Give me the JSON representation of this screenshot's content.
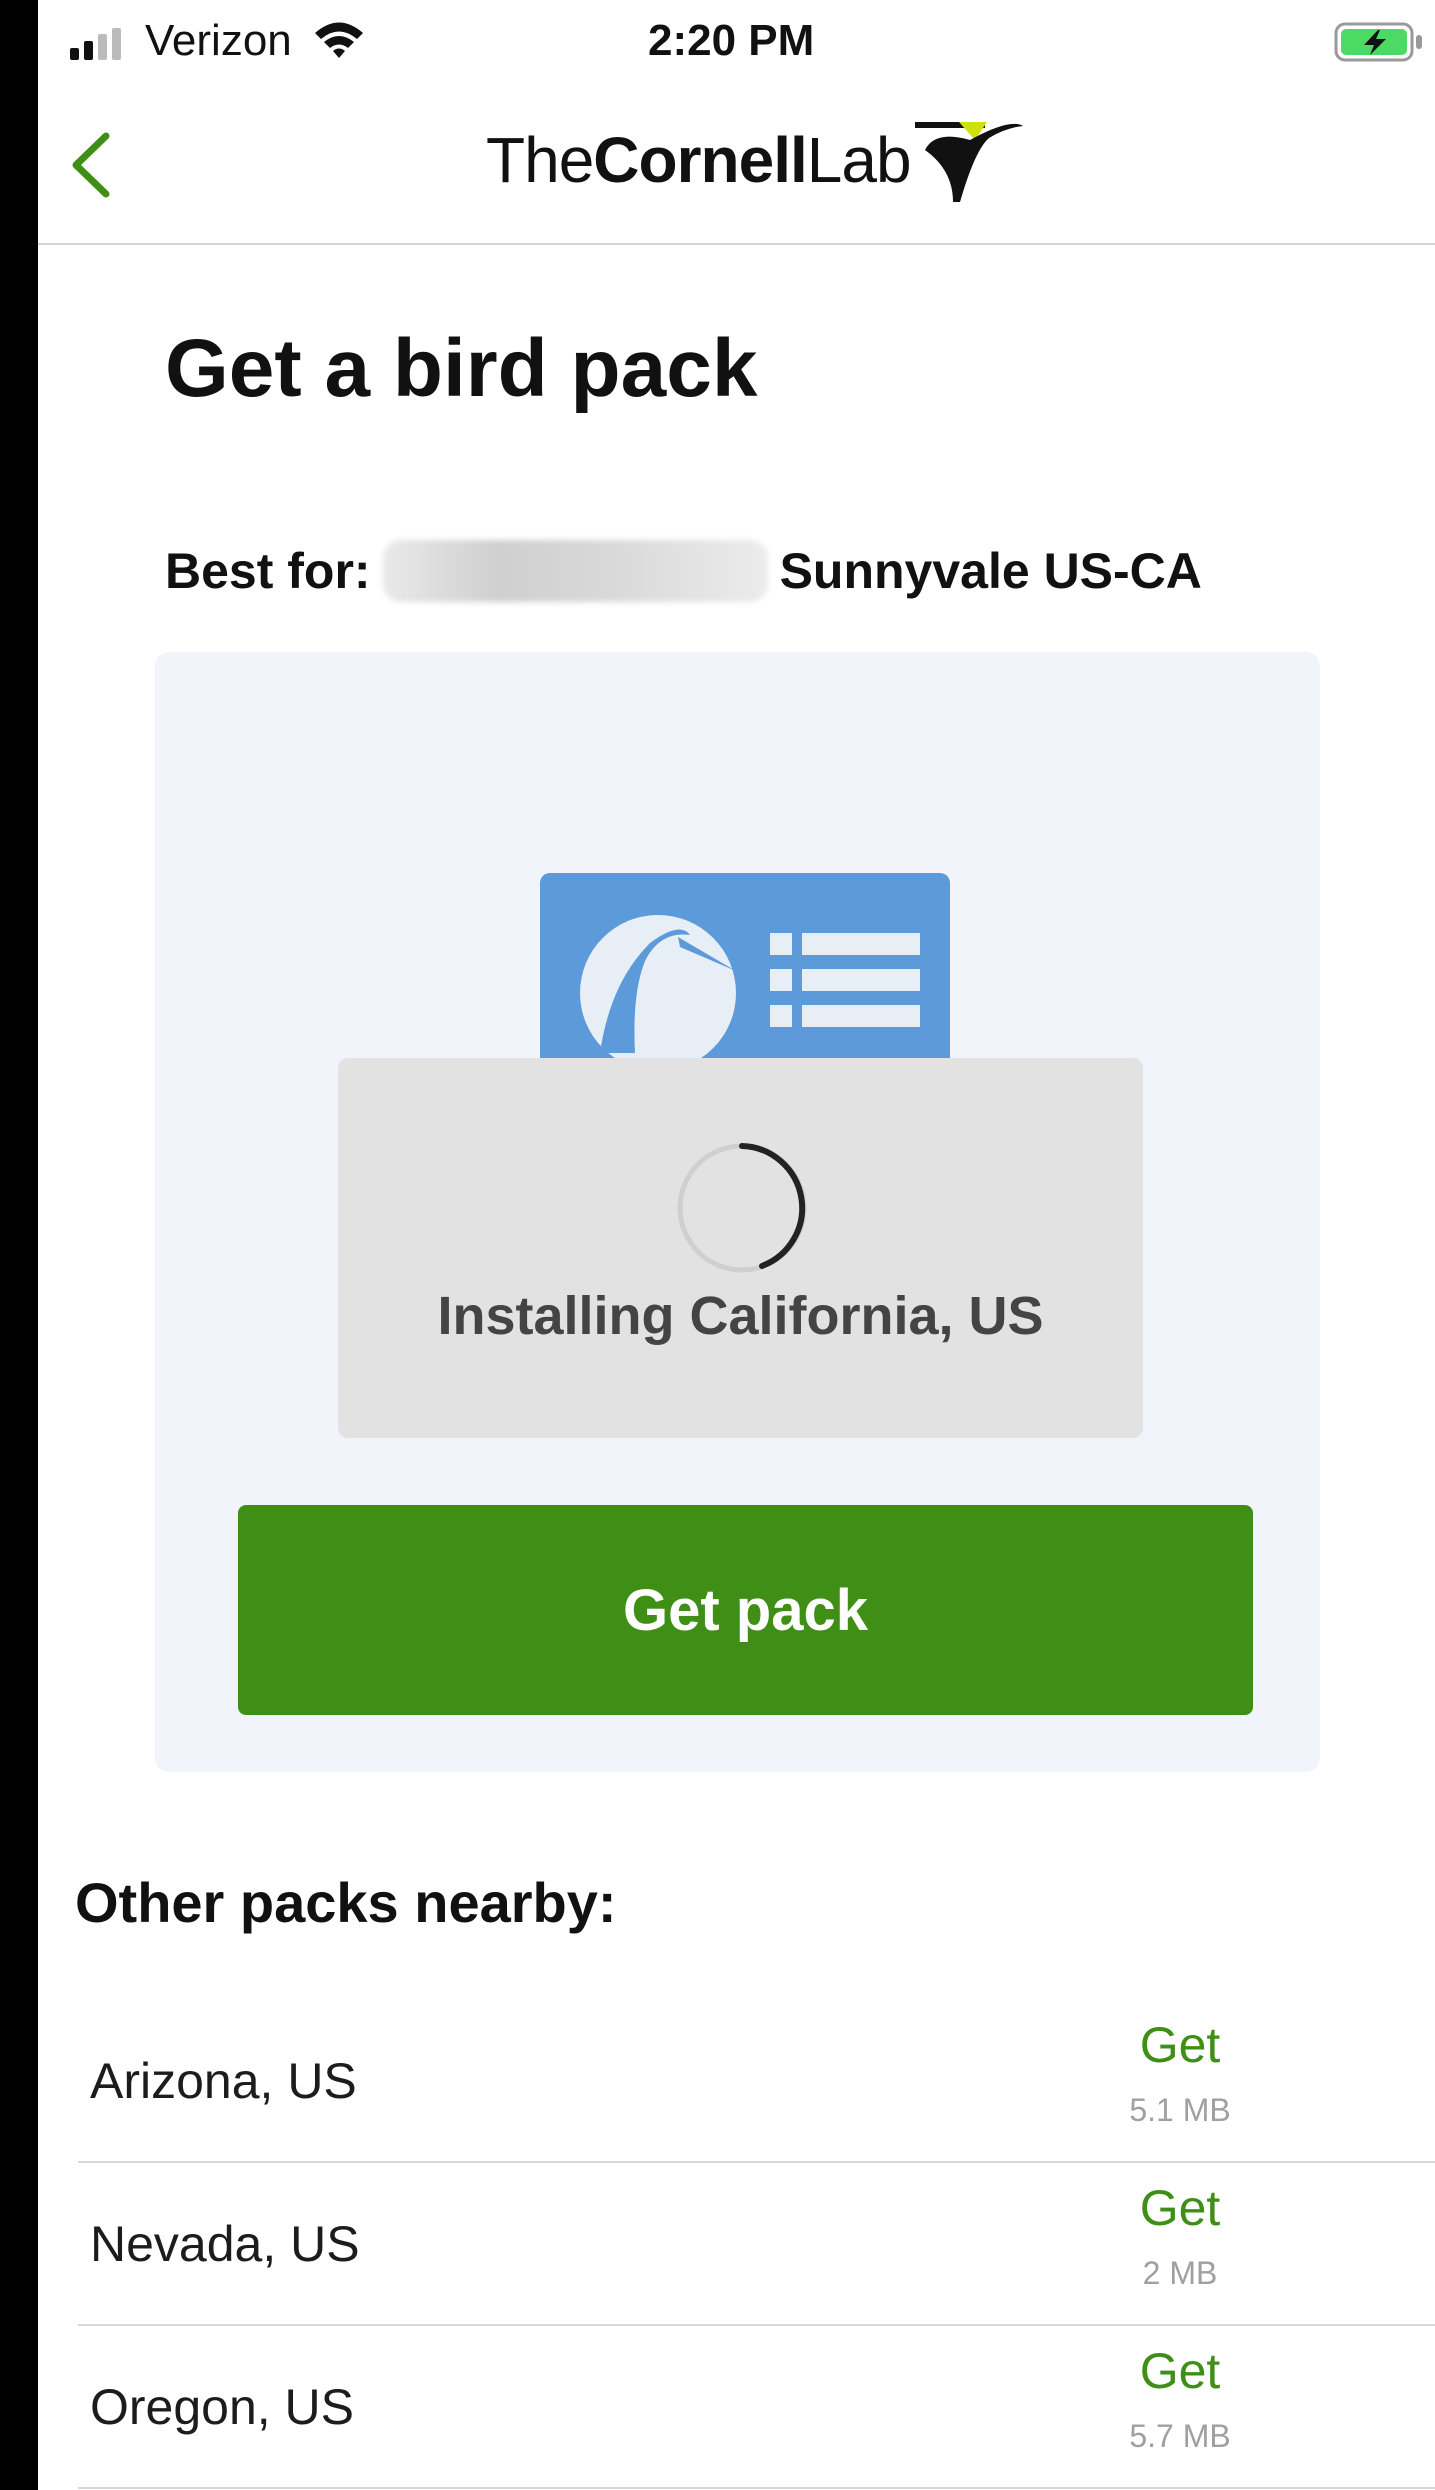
{
  "status_bar": {
    "carrier": "Verizon",
    "time": "2:20 PM",
    "icons": [
      "signal-icon",
      "wifi-icon",
      "battery-charging-icon"
    ]
  },
  "nav": {
    "back_icon": "chevron-left-icon",
    "logo": {
      "the": "The",
      "cornell": "Cornell",
      "lab": "Lab"
    }
  },
  "page": {
    "title": "Get a bird pack",
    "best_for_label": "Best for:",
    "best_for_location": "Sunnyvale US-CA"
  },
  "featured_pack": {
    "installing_text": "Installing California, US",
    "button_label": "Get pack"
  },
  "other_packs": {
    "heading": "Other packs nearby:",
    "items": [
      {
        "name": "Arizona, US",
        "action": "Get",
        "size": "5.1 MB"
      },
      {
        "name": "Nevada, US",
        "action": "Get",
        "size": "2 MB"
      },
      {
        "name": "Oregon, US",
        "action": "Get",
        "size": "5.7 MB"
      }
    ]
  },
  "colors": {
    "accent_green": "#3f8f17",
    "pack_blue": "#5c9ad9",
    "card_bg": "#f1f5fb"
  }
}
